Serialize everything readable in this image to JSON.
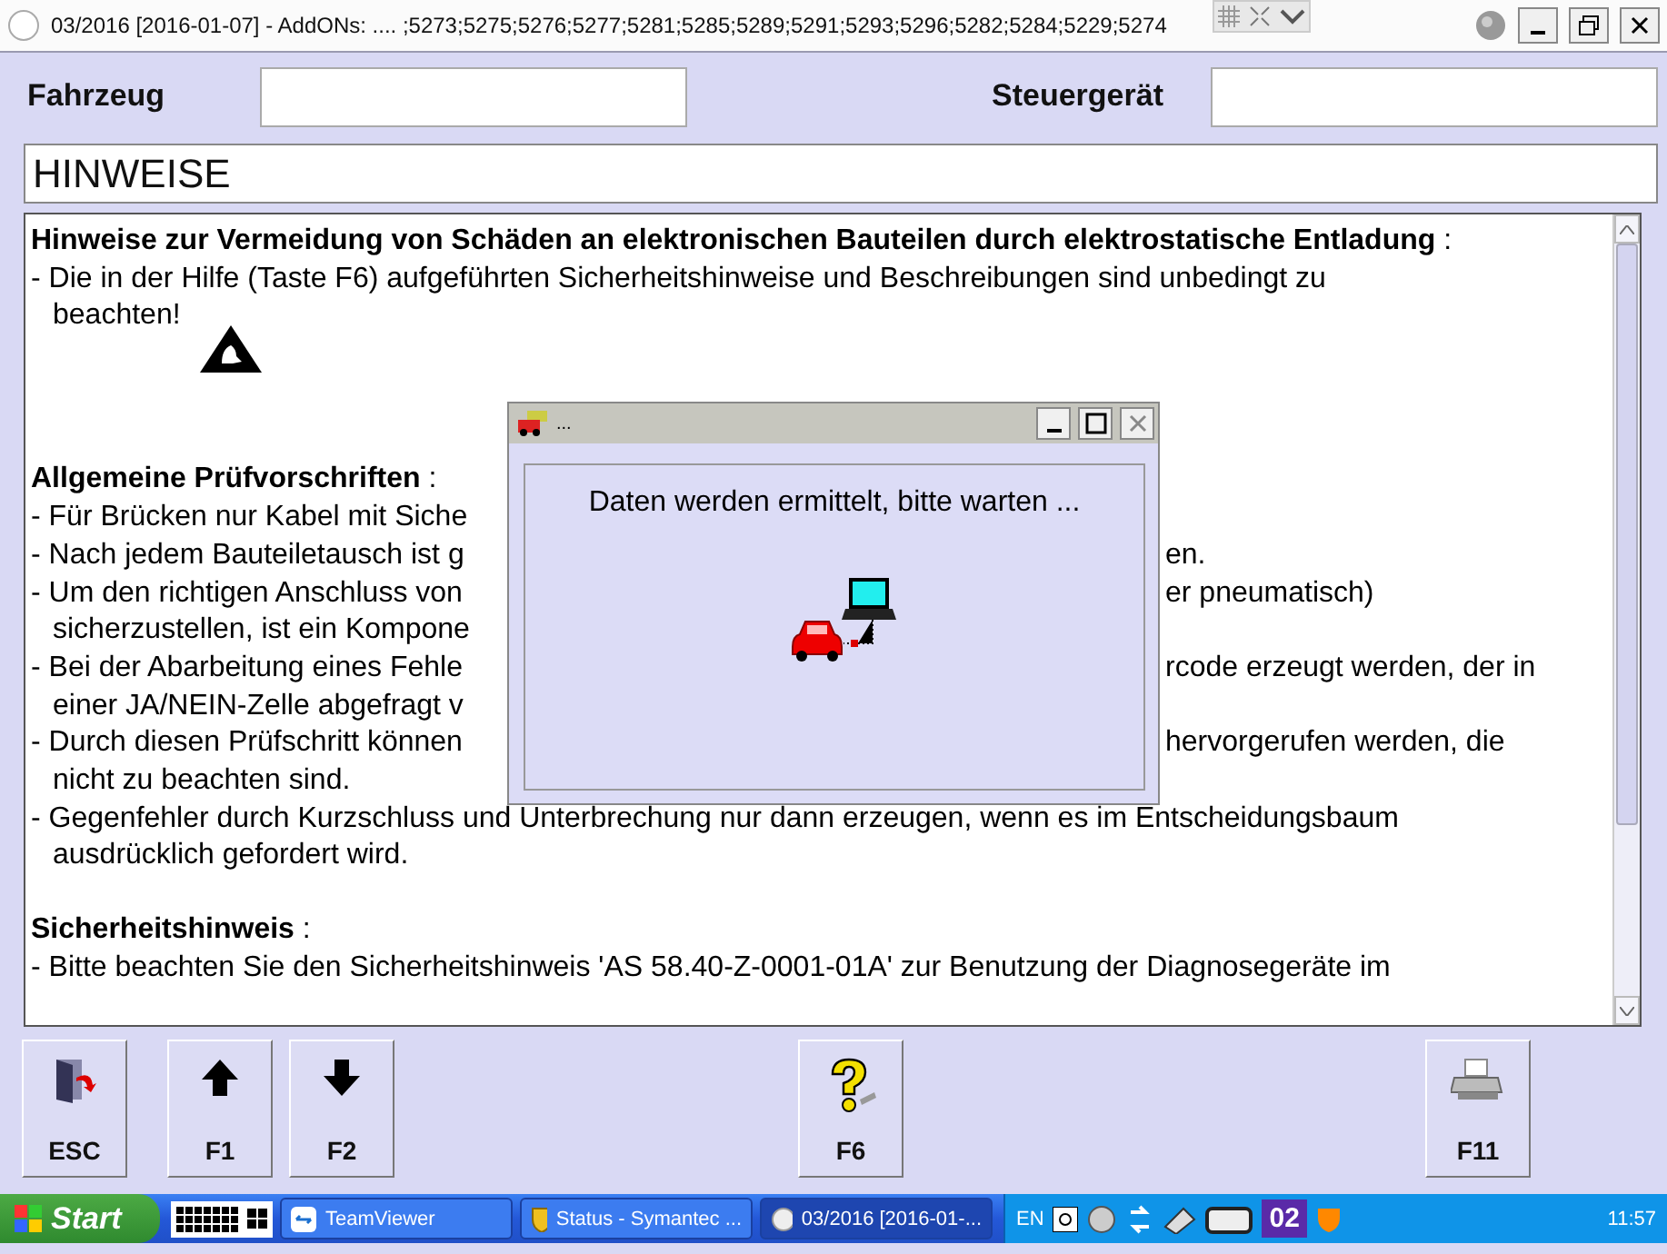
{
  "window": {
    "title": "03/2016 [2016-01-07] - AddONs:  .... ;5273;5275;5276;5277;5281;5285;5289;5291;5293;5296;5282;5284;5229;5274"
  },
  "header": {
    "vehicle_label": "Fahrzeug",
    "control_unit_label": "Steuergerät"
  },
  "section_title": "HINWEISE",
  "content": [
    {
      "heading": "**Hinweise zur Vermeidung von Schäden an elektronischen Bauteilen durch elektrostatische Entladung** :",
      "esd_symbol": true,
      "items": [
        {
          "lines": [
            {
              "left": "- Die in der Hilfe (Taste F6) aufgeführten Sicherheitshinweise und Beschreibungen sind unbedingt zu"
            },
            {
              "left": "beachten!"
            }
          ]
        }
      ]
    },
    {
      "heading": "**Allgemeine Prüfvorschriften** :",
      "esd_symbol": false,
      "items": [
        {
          "lines": [
            {
              "left": "- Für Brücken nur Kabel mit Siche"
            }
          ]
        },
        {
          "lines": [
            {
              "left": "- Nach jedem Bauteiletausch ist g",
              "right": "en."
            }
          ]
        },
        {
          "lines": [
            {
              "left": "- Um den richtigen Anschluss von",
              "right": "er pneumatisch)"
            },
            {
              "left": "sicherzustellen, ist ein Kompone"
            }
          ]
        },
        {
          "lines": [
            {
              "left": "- Bei der Abarbeitung eines Fehle",
              "right": "rcode erzeugt werden, der in"
            },
            {
              "left": "einer JA/NEIN-Zelle abgefragt v"
            }
          ]
        },
        {
          "lines": [
            {
              "left": "- Durch diesen Prüfschritt können",
              "right": "hervorgerufen werden, die"
            },
            {
              "left": "nicht zu beachten sind."
            }
          ]
        },
        {
          "lines": [
            {
              "left": "- Gegenfehler durch Kurzschluss und Unterbrechung nur dann erzeugen, wenn es im Entscheidungsbaum"
            },
            {
              "left": "ausdrücklich gefordert wird."
            }
          ]
        }
      ]
    },
    {
      "heading": "**Sicherheitshinweis** :",
      "esd_symbol": false,
      "items": [
        {
          "lines": [
            {
              "left": "- Bitte beachten Sie den Sicherheitshinweis 'AS 58.40-Z-0001-01A' zur Benutzung der Diagnosegeräte im"
            }
          ]
        }
      ]
    }
  ],
  "dialog": {
    "title": "...",
    "message": "Daten werden ermittelt, bitte warten ..."
  },
  "function_keys": [
    {
      "label": "ESC",
      "kind": "exit"
    },
    {
      "label": "F1",
      "kind": "up"
    },
    {
      "label": "F2",
      "kind": "down"
    },
    {
      "label": "F6",
      "kind": "help"
    },
    {
      "label": "F11",
      "kind": "print"
    }
  ],
  "taskbar": {
    "start": "Start",
    "tasks": [
      {
        "label": "TeamViewer",
        "kind": "teamviewer",
        "selected": false
      },
      {
        "label": "Status - Symantec ...",
        "kind": "shield",
        "selected": false
      },
      {
        "label": "03/2016 [2016-01-...",
        "kind": "app",
        "selected": true
      }
    ],
    "language": "EN",
    "badge": "02",
    "clock": "11:57"
  }
}
